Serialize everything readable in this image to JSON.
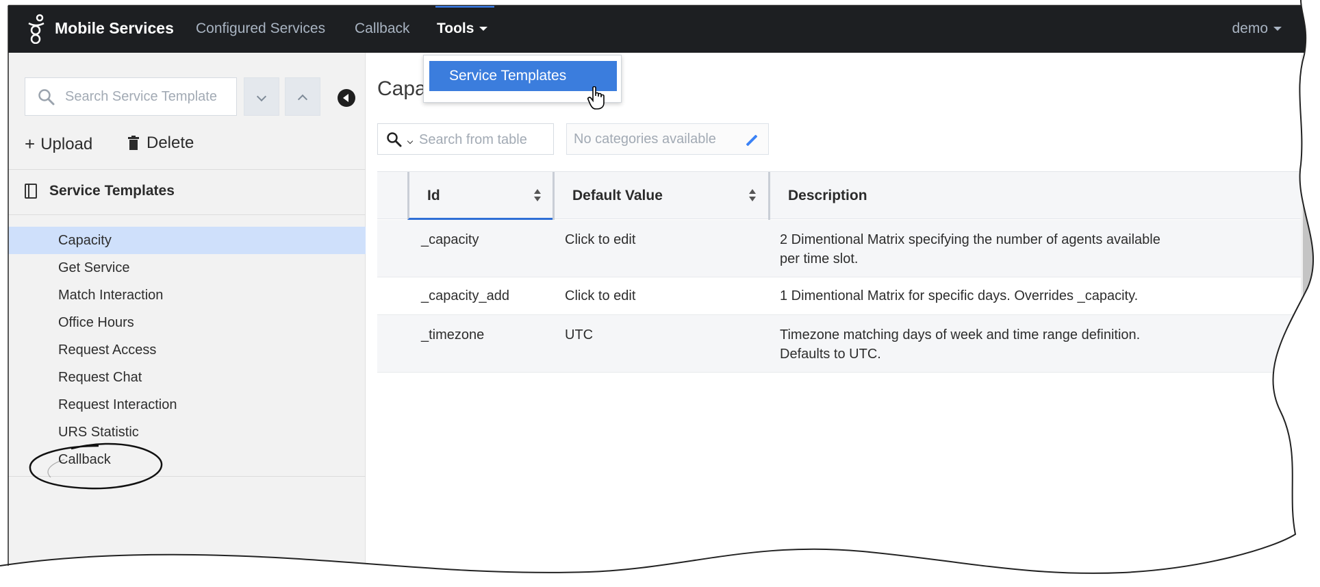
{
  "nav": {
    "brand": "Mobile Services",
    "links": [
      "Configured Services",
      "Callback"
    ],
    "tools": "Tools",
    "user": "demo",
    "dropdown_item": "Service Templates"
  },
  "sidebar": {
    "search_placeholder": "Search Service Template",
    "upload": "Upload",
    "delete": "Delete",
    "section_title": "Service Templates",
    "items": [
      "Capacity",
      "Get Service",
      "Match Interaction",
      "Office Hours",
      "Request Access",
      "Request Chat",
      "Request Interaction",
      "URS Statistic",
      "Callback"
    ],
    "selected": "Capacity"
  },
  "main": {
    "title": "Capacity",
    "table_search_placeholder": "Search from table",
    "categories": "No categories available",
    "columns": [
      "Id",
      "Default Value",
      "Description"
    ],
    "rows": [
      {
        "id": "_capacity",
        "default": "Click to edit",
        "desc1": "2 Dimentional Matrix specifying the number of agents available",
        "desc2": "per time slot."
      },
      {
        "id": "_capacity_add",
        "default": "Click to edit",
        "desc1": "1 Dimentional Matrix for specific days. Overrides _capacity.",
        "desc2": ""
      },
      {
        "id": "_timezone",
        "default": "UTC",
        "desc1": "Timezone matching days of week and time range definition.",
        "desc2": "Defaults to UTC."
      }
    ]
  },
  "colors": {
    "topbar": "#1d1f22",
    "accent": "#3b7ddd",
    "selected_row": "#cfe0fb"
  }
}
